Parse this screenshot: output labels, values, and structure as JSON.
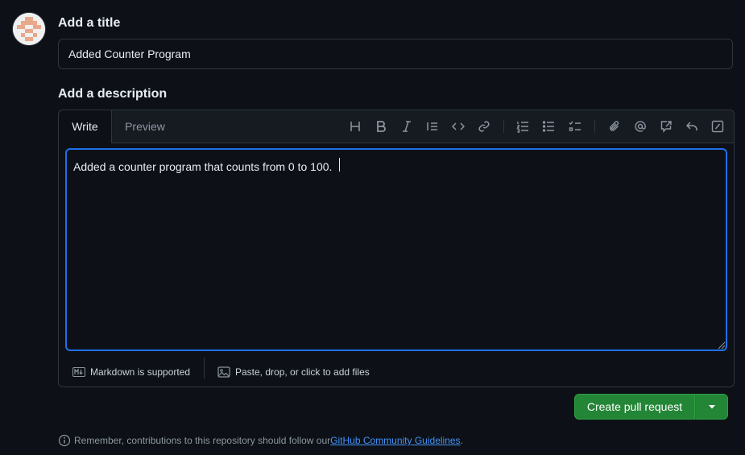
{
  "title_section": {
    "label": "Add a title",
    "value": "Added Counter Program"
  },
  "description_section": {
    "label": "Add a description",
    "tabs": [
      {
        "label": "Write",
        "active": true
      },
      {
        "label": "Preview",
        "active": false
      }
    ],
    "toolbar_icons": [
      "heading-icon",
      "bold-icon",
      "italic-icon",
      "quote-icon",
      "code-icon",
      "link-icon",
      "ordered-list-icon",
      "unordered-list-icon",
      "task-list-icon",
      "attach-icon",
      "mention-icon",
      "cross-reference-icon",
      "saved-reply-icon",
      "slash-command-icon"
    ],
    "body": "Added a counter program that counts from 0 to 100. ",
    "footer": {
      "markdown": "Markdown is supported",
      "files": "Paste, drop, or click to add files"
    }
  },
  "actions": {
    "primary": "Create pull request"
  },
  "note": {
    "text": "Remember, contributions to this repository should follow our ",
    "link": "GitHub Community Guidelines",
    "suffix": "."
  },
  "colors": {
    "background": "#0d1117",
    "accent_blue": "#1f6feb",
    "button_green": "#238636",
    "link": "#4493f8"
  }
}
